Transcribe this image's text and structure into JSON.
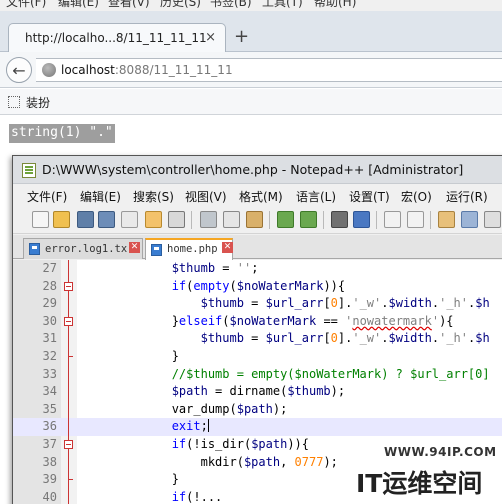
{
  "browser": {
    "menu": [
      "文件(F)",
      "编辑(E)",
      "查看(V)",
      "历史(S)",
      "书签(B)",
      "工具(T)",
      "帮助(H)"
    ],
    "tab_title": "http://localho...8/11_11_11_11",
    "tab_close": "×",
    "new_tab": "+",
    "url_host": "localhost",
    "url_path": ":8088/11_11_11_11",
    "bookmark_label": "装扮"
  },
  "page": {
    "output": "string(1) \".\""
  },
  "notepad": {
    "title": "D:\\WWW\\system\\controller\\home.php - Notepad++ [Administrator]",
    "menu": [
      "文件(F)",
      "编辑(E)",
      "搜索(S)",
      "视图(V)",
      "格式(M)",
      "语言(L)",
      "设置(T)",
      "宏(O)",
      "运行(R)"
    ],
    "tabs": [
      {
        "label": "error.log1.tx"
      },
      {
        "label": "home.php",
        "active": true
      }
    ],
    "current_line": 36,
    "lines": [
      {
        "n": "27",
        "code": "            $thumb = '';"
      },
      {
        "n": "28",
        "code": "            if(empty($noWaterMark)){"
      },
      {
        "n": "29",
        "code": "                $thumb = $url_arr[0].'_w'.$width.'_h'.$h"
      },
      {
        "n": "30",
        "code": "            }elseif($noWaterMark == 'nowatermark'){"
      },
      {
        "n": "31",
        "code": "                $thumb = $url_arr[0].'_w'.$width.'_h'.$h"
      },
      {
        "n": "32",
        "code": "            }"
      },
      {
        "n": "33",
        "code": "            //$thumb = empty($noWaterMark) ? $url_arr[0]"
      },
      {
        "n": "34",
        "code": "            $path = dirname($thumb);"
      },
      {
        "n": "35",
        "code": "            var_dump($path);"
      },
      {
        "n": "36",
        "code": "            exit;"
      },
      {
        "n": "37",
        "code": "            if(!is_dir($path)){"
      },
      {
        "n": "38",
        "code": "                mkdir($path, 0777);"
      },
      {
        "n": "39",
        "code": "            }"
      },
      {
        "n": "40",
        "code": "            if(!..."
      }
    ]
  },
  "watermark": {
    "url": "WWW.94IP.COM",
    "text": "IT运维空间"
  },
  "colors": {
    "keyword": "#0000ff",
    "variable": "#000080",
    "string": "#808080",
    "comment": "#008000",
    "number": "#ff8000",
    "fold": "#cc3333"
  }
}
